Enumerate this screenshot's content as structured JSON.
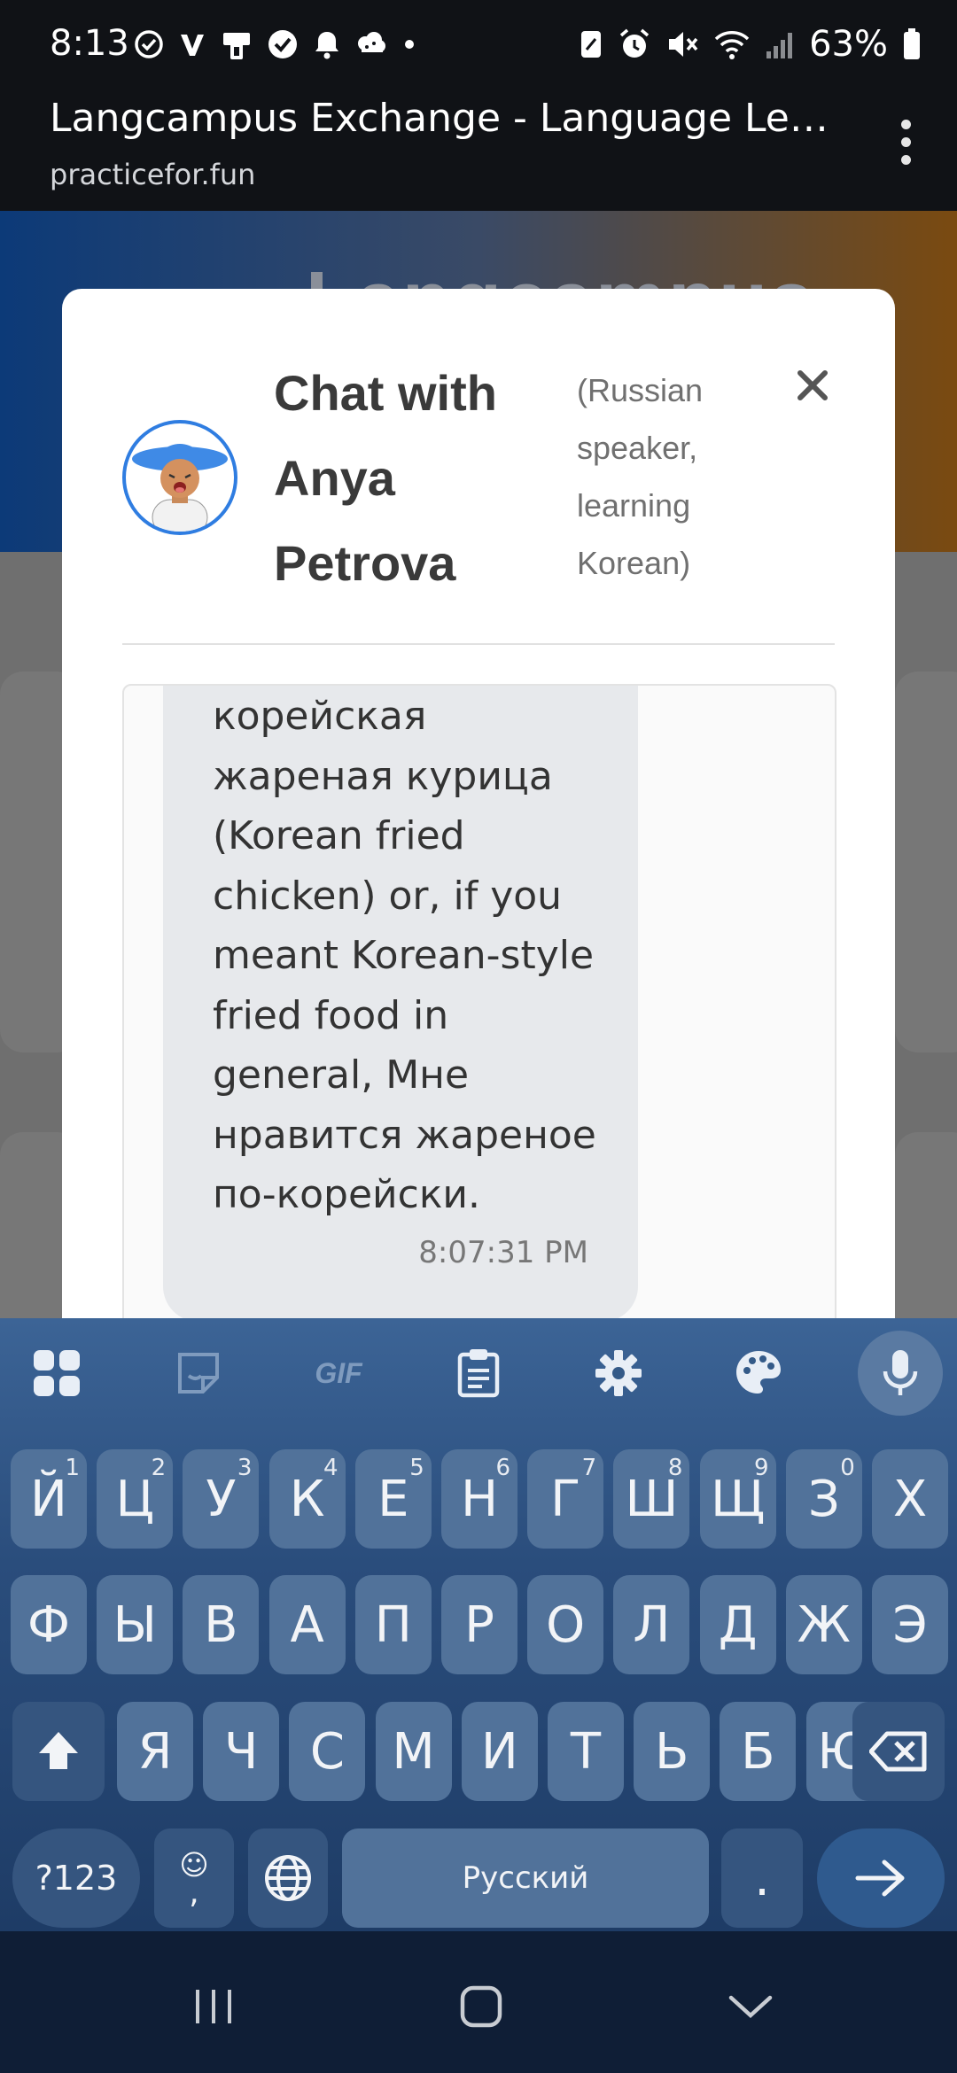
{
  "status_bar": {
    "time": "8:13",
    "battery_percent": "63%",
    "left_icons": [
      "check-circle-icon",
      "v-app-icon",
      "device-icon",
      "verified-icon",
      "bell-icon",
      "cloud-icon",
      "dot-icon"
    ],
    "right_icons": [
      "nfc-icon",
      "alarm-icon",
      "mute-icon",
      "wifi-icon",
      "signal-icon",
      "battery-icon"
    ]
  },
  "browser": {
    "title": "Langcampus Exchange - Language Learni...",
    "url": "practicefor.fun",
    "hero_text": "Langcampus"
  },
  "chat": {
    "title": "Chat with Anya Petrova",
    "subtitle": "(Russian speaker, learning Korean)",
    "close_symbol": "×",
    "messages": [
      {
        "text": "корейская жареная курица (Korean fried chicken) or, if you meant Korean-style fried food in general, Мне нравится жареное по-корейски.",
        "time": "8:07:31 PM"
      }
    ]
  },
  "keyboard": {
    "toolbar": [
      "apps-grid-icon",
      "sticker-icon",
      "gif-icon",
      "clipboard-icon",
      "settings-gear-icon",
      "palette-icon",
      "mic-icon"
    ],
    "gif_label": "GIF",
    "row1": [
      {
        "label": "Й",
        "hint": "1"
      },
      {
        "label": "Ц",
        "hint": "2"
      },
      {
        "label": "У",
        "hint": "3"
      },
      {
        "label": "К",
        "hint": "4"
      },
      {
        "label": "Е",
        "hint": "5"
      },
      {
        "label": "Н",
        "hint": "6"
      },
      {
        "label": "Г",
        "hint": "7"
      },
      {
        "label": "Ш",
        "hint": "8"
      },
      {
        "label": "Щ",
        "hint": "9"
      },
      {
        "label": "З",
        "hint": "0"
      },
      {
        "label": "Х",
        "hint": ""
      }
    ],
    "row2": [
      "Ф",
      "Ы",
      "В",
      "А",
      "П",
      "Р",
      "О",
      "Л",
      "Д",
      "Ж",
      "Э"
    ],
    "row3": [
      "Я",
      "Ч",
      "С",
      "М",
      "И",
      "Т",
      "Ь",
      "Б",
      "Ю"
    ],
    "symbols_label": "?123",
    "emoji_top": "☺",
    "emoji_bottom": ",",
    "space_label": "Русский",
    "period_label": ".",
    "enter_symbol": "→"
  },
  "nav": {
    "buttons": [
      "recents-icon",
      "home-icon",
      "back-icon"
    ]
  },
  "colors": {
    "accent": "#2f7de1",
    "keyboard_bg": "#2a4d7c",
    "key_bg": "#51729a",
    "bubble_bg": "#e7e9ec"
  }
}
